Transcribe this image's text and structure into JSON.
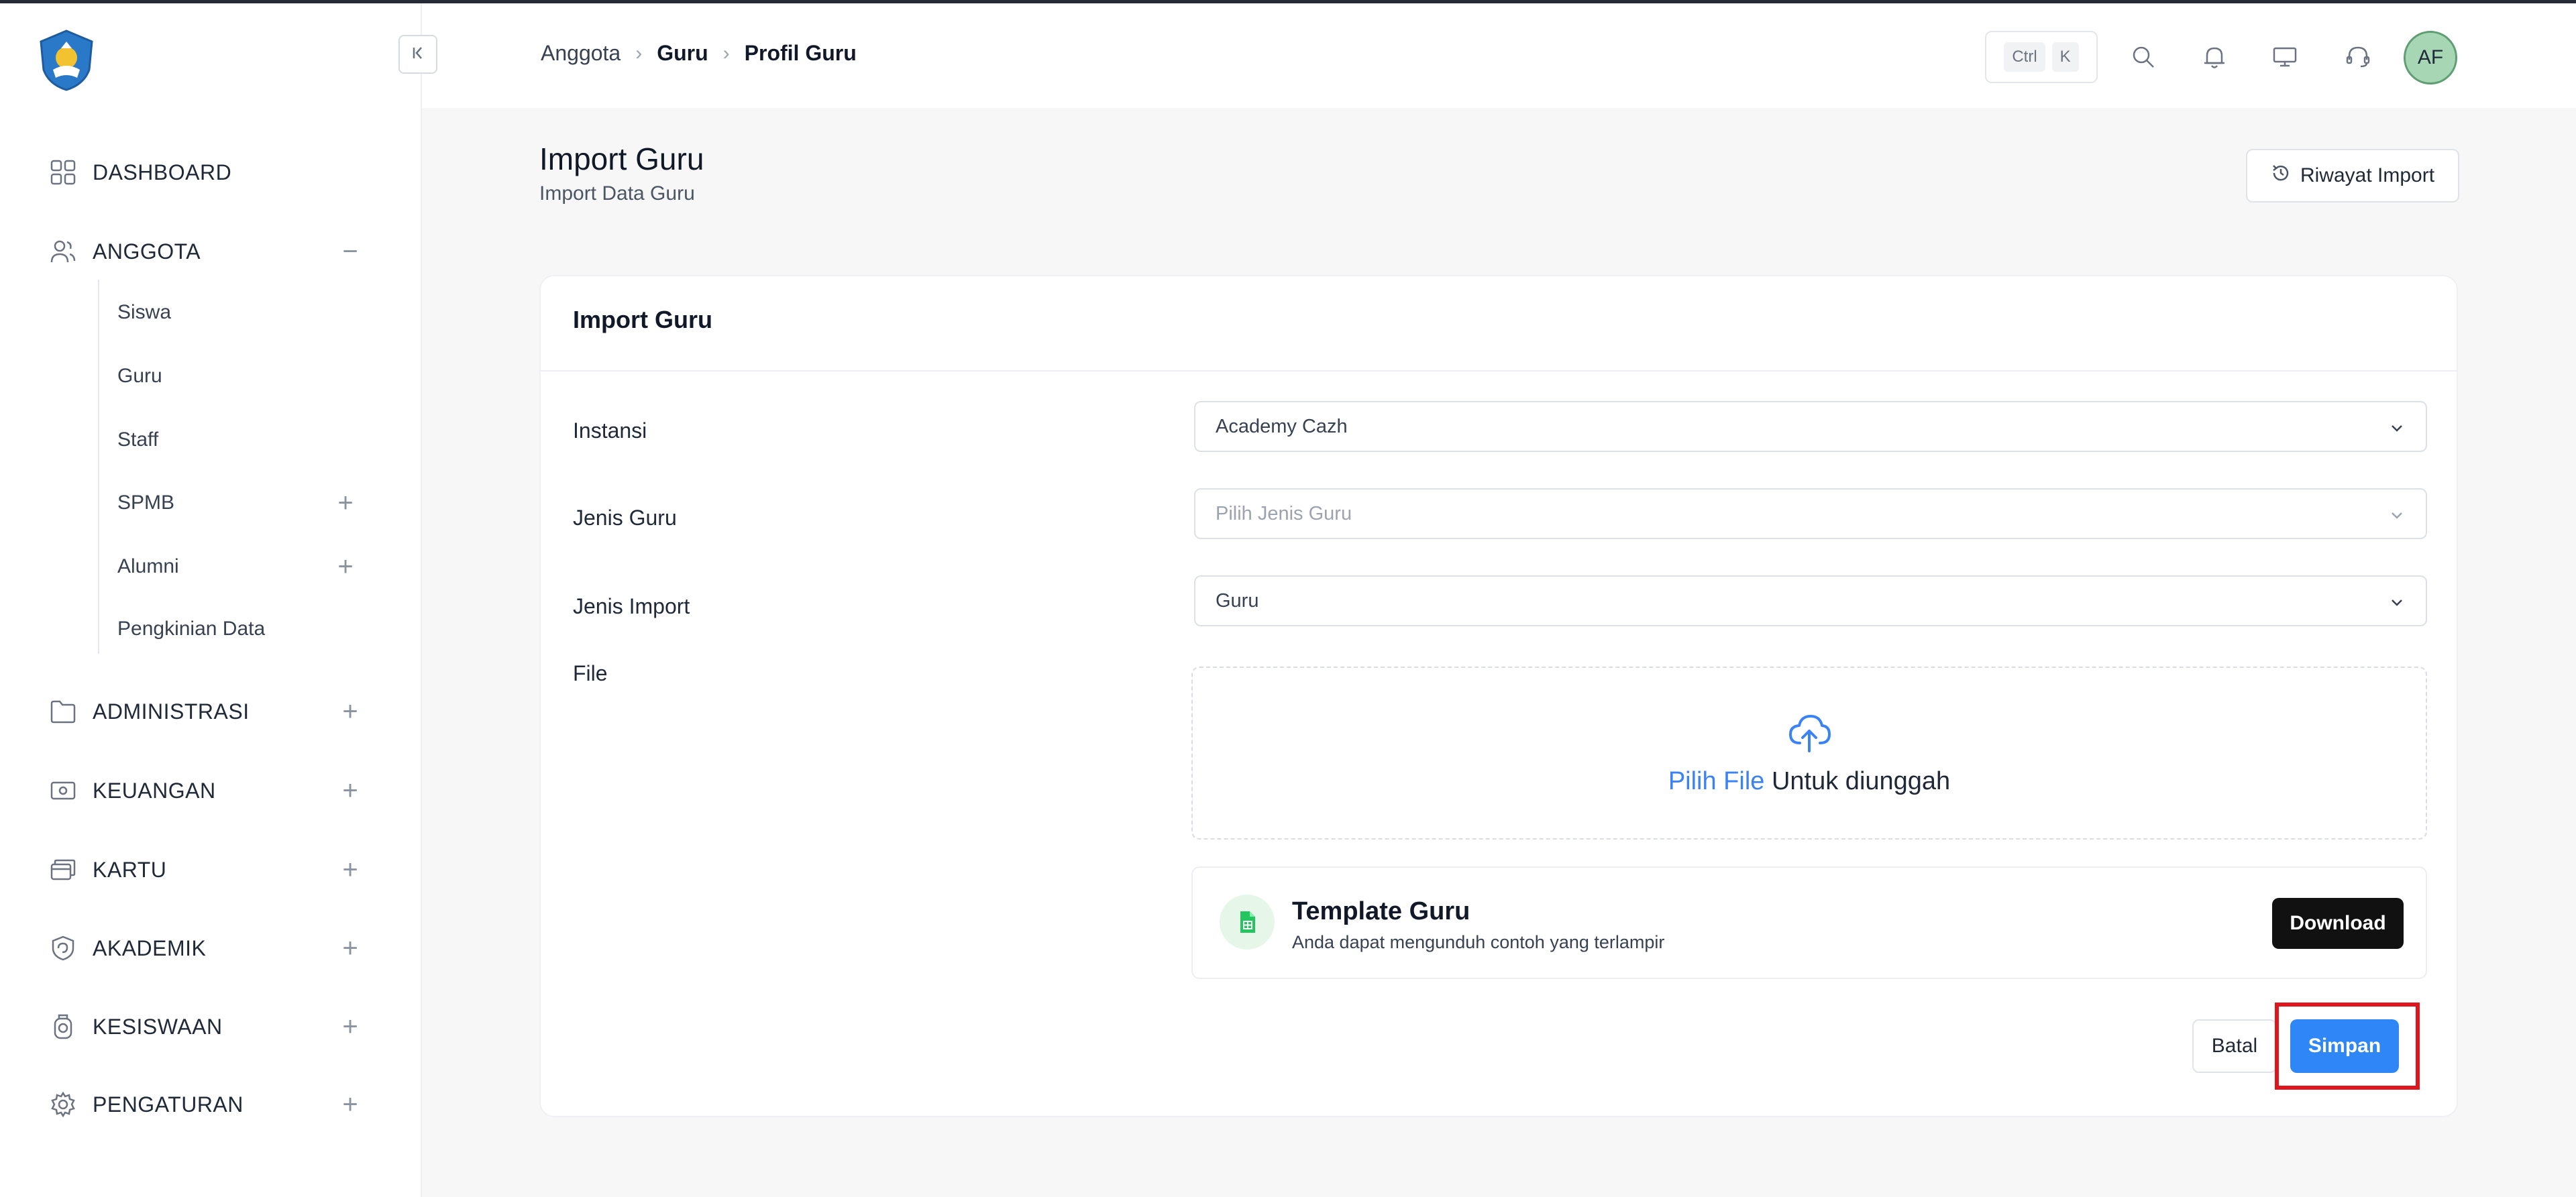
{
  "sidebar": {
    "items": [
      {
        "label": "DASHBOARD",
        "icon": "dashboard-icon",
        "toggle": ""
      },
      {
        "label": "ANGGOTA",
        "icon": "users-icon",
        "toggle": "−"
      },
      {
        "label": "ADMINISTRASI",
        "icon": "folder-icon",
        "toggle": "+"
      },
      {
        "label": "KEUANGAN",
        "icon": "money-icon",
        "toggle": "+"
      },
      {
        "label": "KARTU",
        "icon": "cards-icon",
        "toggle": "+"
      },
      {
        "label": "AKADEMIK",
        "icon": "academic-icon",
        "toggle": "+"
      },
      {
        "label": "KESISWAAN",
        "icon": "student-icon",
        "toggle": "+"
      },
      {
        "label": "PENGATURAN",
        "icon": "gear-icon",
        "toggle": "+"
      }
    ],
    "anggota_sub": [
      {
        "label": "Siswa",
        "toggle": ""
      },
      {
        "label": "Guru",
        "toggle": ""
      },
      {
        "label": "Staff",
        "toggle": ""
      },
      {
        "label": "SPMB",
        "toggle": "+"
      },
      {
        "label": "Alumni",
        "toggle": "+"
      },
      {
        "label": "Pengkinian Data",
        "toggle": ""
      }
    ]
  },
  "header": {
    "breadcrumb": [
      "Anggota",
      "Guru",
      "Profil Guru"
    ],
    "shortcut": {
      "key1": "Ctrl",
      "key2": "K"
    },
    "avatar_initials": "AF"
  },
  "page": {
    "title": "Import Guru",
    "subtitle": "Import Data Guru",
    "history_button": "Riwayat Import"
  },
  "form": {
    "card_title": "Import Guru",
    "instansi": {
      "label": "Instansi",
      "value": "Academy Cazh"
    },
    "jenis_guru": {
      "label": "Jenis Guru",
      "placeholder": "Pilih Jenis Guru"
    },
    "jenis_import": {
      "label": "Jenis Import",
      "value": "Guru"
    },
    "file": {
      "label": "File",
      "link_text": "Pilih File",
      "rest_text": " Untuk diunggah"
    },
    "template": {
      "title": "Template Guru",
      "description": "Anda dapat mengunduh contoh yang terlampir",
      "download_label": "Download"
    },
    "cancel_label": "Batal",
    "save_label": "Simpan"
  },
  "colors": {
    "accent": "#2f86f6",
    "highlight": "#e0161e",
    "dark_button": "#111111"
  }
}
